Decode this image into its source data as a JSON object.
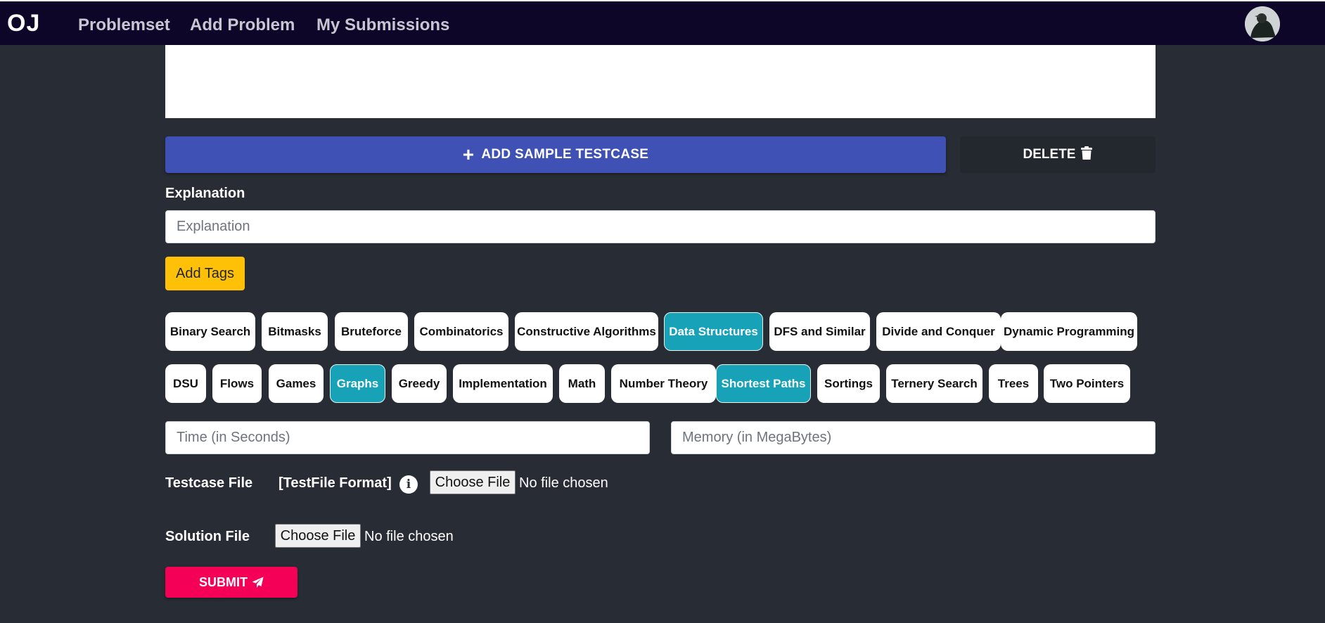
{
  "navbar": {
    "brand": "OJ",
    "links": [
      "Problemset",
      "Add Problem",
      "My Submissions"
    ]
  },
  "buttons": {
    "add_sample": "ADD SAMPLE TESTCASE",
    "delete": "DELETE",
    "add_tags": "Add Tags",
    "submit": "SUBMIT"
  },
  "explanation": {
    "label": "Explanation",
    "placeholder": "Explanation"
  },
  "tags": {
    "row1": [
      {
        "label": "Binary Search",
        "selected": false
      },
      {
        "label": "Bitmasks",
        "selected": false
      },
      {
        "label": "Bruteforce",
        "selected": false
      },
      {
        "label": "Combinatorics",
        "selected": false
      },
      {
        "label": "Constructive Algorithms",
        "selected": false
      },
      {
        "label": "Data Structures",
        "selected": true
      },
      {
        "label": "DFS and Similar",
        "selected": false
      },
      {
        "label": "Divide and Conquer",
        "selected": false
      },
      {
        "label": "Dynamic Programming",
        "selected": false
      }
    ],
    "row2": [
      {
        "label": "DSU",
        "selected": false
      },
      {
        "label": "Flows",
        "selected": false
      },
      {
        "label": "Games",
        "selected": false
      },
      {
        "label": "Graphs",
        "selected": true
      },
      {
        "label": "Greedy",
        "selected": false
      },
      {
        "label": "Implementation",
        "selected": false
      },
      {
        "label": "Math",
        "selected": false
      },
      {
        "label": "Number Theory",
        "selected": false
      },
      {
        "label": "Shortest Paths",
        "selected": true
      },
      {
        "label": "Sortings",
        "selected": false
      },
      {
        "label": "Ternery Search",
        "selected": false
      },
      {
        "label": "Trees",
        "selected": false
      },
      {
        "label": "Two Pointers",
        "selected": false
      }
    ]
  },
  "limits": {
    "time_placeholder": "Time (in Seconds)",
    "memory_placeholder": "Memory (in MegaBytes)"
  },
  "files": {
    "testcase_label": "Testcase File",
    "format_label": "[TestFile Format]",
    "choose_file": "Choose File",
    "no_file": "No file chosen",
    "solution_label": "Solution File"
  },
  "colors": {
    "background": "#282c34",
    "navbar": "#0d0628",
    "primary": "#3f51b5",
    "tag_selected": "#17a2b8",
    "warning": "#ffc107",
    "submit": "#f50057"
  }
}
